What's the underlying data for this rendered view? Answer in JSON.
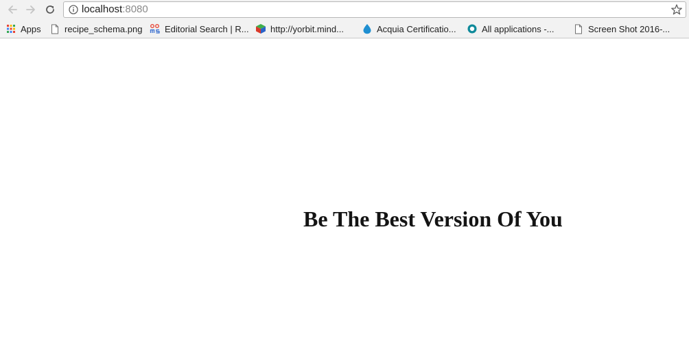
{
  "browser": {
    "address_bar": {
      "host": "localhost",
      "port": ":8080"
    },
    "icons": {
      "back": "arrow-left-icon",
      "forward": "arrow-right-icon",
      "reload": "reload-icon",
      "site_info": "info-icon",
      "bookmark_star": "star-icon"
    },
    "bookmarks": [
      {
        "label": "Apps",
        "icon": "apps-grid-icon"
      },
      {
        "label": "recipe_schema.png",
        "icon": "document-icon"
      },
      {
        "label": "Editorial Search | R...",
        "icon": "site-logo-icon"
      },
      {
        "label": "http://yorbit.mind...",
        "icon": "cube-icon"
      },
      {
        "label": "Acquia Certificatio...",
        "icon": "drop-icon"
      },
      {
        "label": "All applications -...",
        "icon": "ring-icon"
      },
      {
        "label": "Screen Shot 2016-...",
        "icon": "document-icon"
      }
    ]
  },
  "page": {
    "headline": "Be The Best Version Of You"
  },
  "colors": {
    "chrome_background": "#f2f2f2",
    "page_background": "#ffffff",
    "headline_text": "#141414",
    "url_port_text": "#8a8a8a"
  }
}
